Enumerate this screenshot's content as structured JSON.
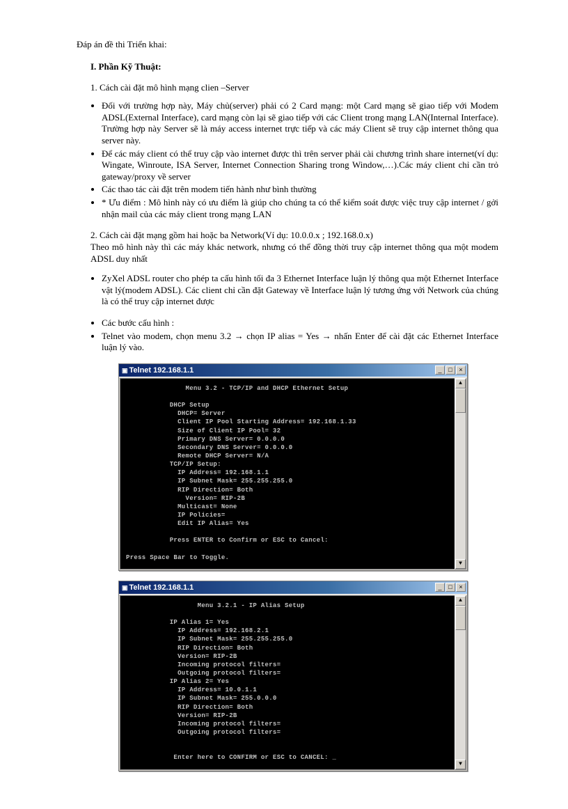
{
  "header": "Đáp án đề thi Triển khai:",
  "section1": {
    "heading": "I.   Phần Kỹ Thuật:",
    "item1": "1.  Cách cài  đặt mô hình mạng clien –Server",
    "bullets1": [
      "Đối với trường hợp này, Máy chủ(server) phải có 2 Card mạng: một Card mạng sẽ giao tiếp với Modem ADSL(External Interface), card mạng còn lại sẽ giao tiếp với các Client trong mạng LAN(Internal Interface). Trường hợp này Server sẽ là máy access internet trực tiếp và các máy Client sẽ truy cập internet thông qua server này.",
      "Để các máy client có thể truy cập vào internet được thì trên server phải cài chương trình share internet(ví dụ: Wingate, Winroute, ISA Server, Internet Connection Sharing trong Window,…).Các máy client chỉ cần trỏ gateway/proxy về server",
      "Các thao tác cài đặt trên modem tiến hành như bình thường",
      "* Ưu điểm : Mô hình này có ưu điểm là giúp cho chúng ta có thể kiểm soát được việc truy cập internet / gởi nhận mail của các máy client trong mạng LAN"
    ],
    "item2_a": "2.     Cách cài đặt mạng gồm hai hoặc ba Network(Ví dụ: 10.0.0.x ; 192.168.0.x)",
    "item2_b": "Theo mô hình này thì các máy khác network, nhưng có thể đồng thời truy cập internet thông qua một modem ADSL duy nhất",
    "bullets2": [
      "ZyXel ADSL router cho phép ta cấu hình tối đa 3 Ethernet Interface luận lý thông qua một Ethernet Interface vật lý(modem ADSL). Các client chỉ cần đặt Gateway về Interface luận lý tương ứng với Network của chúng là có thể truy cập internet được"
    ],
    "bullets3": [
      "Các bước cấu hình :",
      "Telnet vào modem,  chọn menu 3.2 → chọn IP alias = Yes → nhấn Enter để cài đặt các Ethernet Interface luận lý vào."
    ]
  },
  "terminal1": {
    "title": "Telnet 192.168.1.1",
    "content": "               Menu 3.2 - TCP/IP and DHCP Ethernet Setup\n\n           DHCP Setup\n             DHCP= Server\n             Client IP Pool Starting Address= 192.168.1.33\n             Size of Client IP Pool= 32\n             Primary DNS Server= 0.0.0.0\n             Secondary DNS Server= 0.0.0.0\n             Remote DHCP Server= N/A\n           TCP/IP Setup:\n             IP Address= 192.168.1.1\n             IP Subnet Mask= 255.255.255.0\n             RIP Direction= Both\n               Version= RIP-2B\n             Multicast= None\n             IP Policies=\n             Edit IP Alias= Yes\n\n           Press ENTER to Confirm or ESC to Cancel:\n\nPress Space Bar to Toggle."
  },
  "terminal2": {
    "title": "Telnet 192.168.1.1",
    "content": "                  Menu 3.2.1 - IP Alias Setup\n\n           IP Alias 1= Yes\n             IP Address= 192.168.2.1\n             IP Subnet Mask= 255.255.255.0\n             RIP Direction= Both\n             Version= RIP-2B\n             Incoming protocol filters=\n             Outgoing protocol filters=\n           IP Alias 2= Yes\n             IP Address= 10.0.1.1\n             IP Subnet Mask= 255.0.0.0\n             RIP Direction= Both\n             Version= RIP-2B\n             Incoming protocol filters=\n             Outgoing protocol filters=\n\n\n            Enter here to CONFIRM or ESC to CANCEL: _"
  },
  "winbtns": {
    "min": "_",
    "max": "□",
    "close": "×",
    "up": "▲",
    "down": "▼"
  }
}
